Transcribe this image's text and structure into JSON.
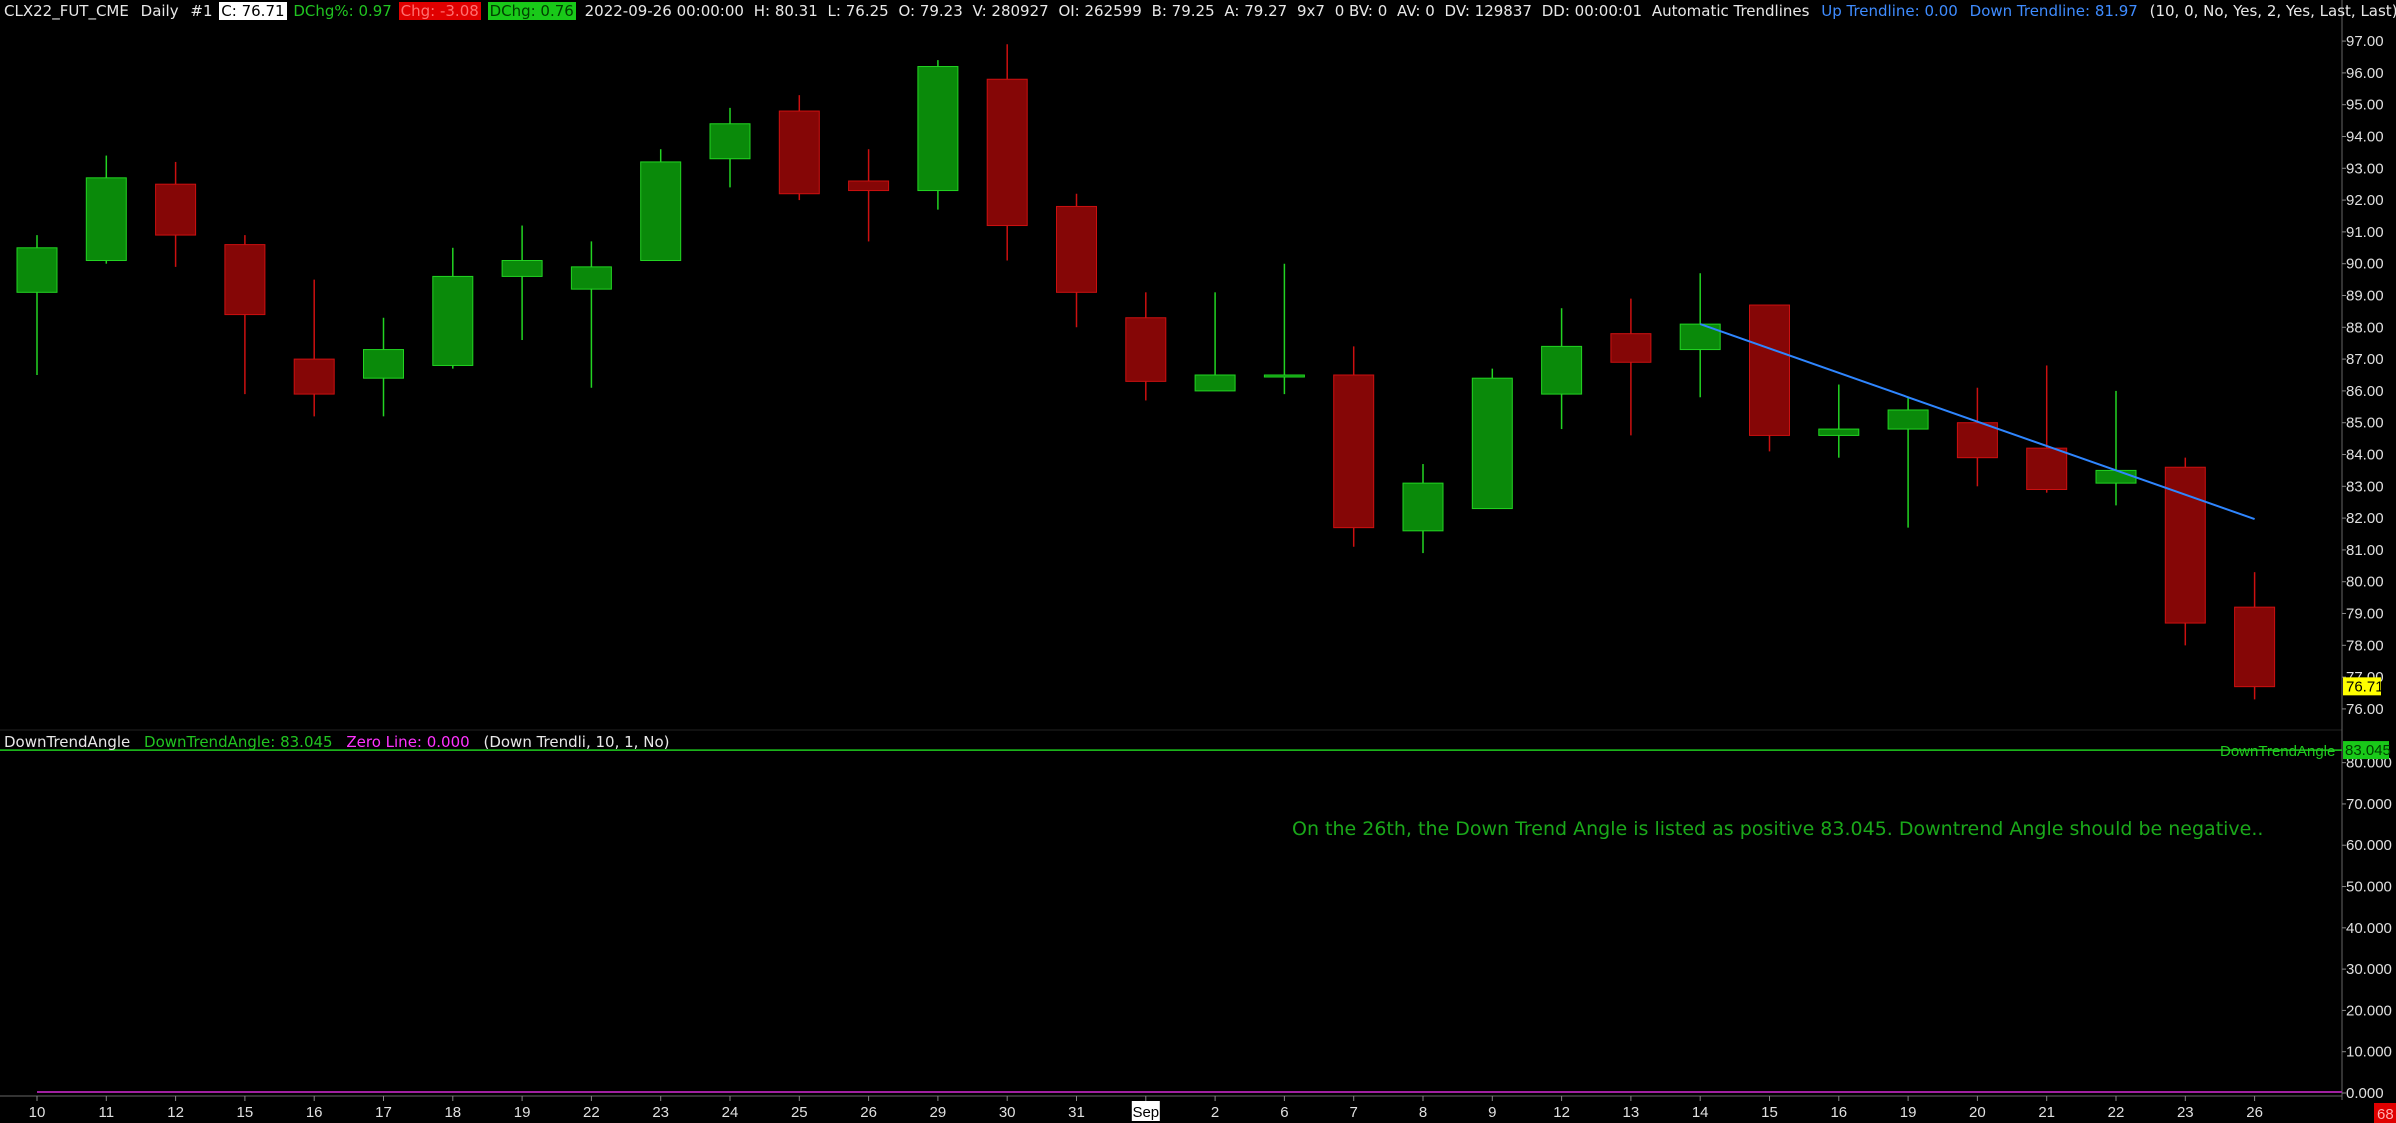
{
  "header": {
    "symbol": "CLX22_FUT_CME",
    "interval": "Daily",
    "chart_no": "#1",
    "close": "C: 76.71",
    "dchg_pct": "DChg%: 0.97",
    "chg": "Chg: -3.08",
    "dchg": "DChg: 0.76",
    "datetime": "2022-09-26 00:00:00",
    "high": "H: 80.31",
    "low": "L: 76.25",
    "open": "O: 79.23",
    "volume": "V: 280927",
    "oi": "OI: 262599",
    "bid": "B: 79.25",
    "ask": "A: 79.27",
    "size": "9x7",
    "bv": "0 BV: 0",
    "av": "AV: 0",
    "dv": "DV: 129837",
    "dd": "DD: 00:00:01",
    "study": "Automatic Trendlines",
    "up_trendline": "Up Trendline: 0.00",
    "down_trendline": "Down Trendline: 81.97",
    "params": "(10, 0, No, Yes, 2, Yes, Last, Last)"
  },
  "subheader": {
    "study": "DownTrendAngle",
    "value": "DownTrendAngle: 83.045",
    "zero": "Zero Line: 0.000",
    "params": "(Down Trendli, 10, 1, No)"
  },
  "annotation": "On the 26th, the Down Trend Angle is listed as positive 83.045.  Downtrend Angle should be negative..",
  "colors": {
    "up": "#0a8a0a",
    "up_border": "#22d422",
    "down": "#850606",
    "down_border": "#cc1010",
    "trendline": "#2f86ff",
    "indicator": "#1fcc1f",
    "zero_line": "#a020a0"
  },
  "chart_data": [
    {
      "type": "candlestick",
      "categories": [
        "10",
        "11",
        "12",
        "15",
        "16",
        "17",
        "18",
        "19",
        "22",
        "23",
        "24",
        "25",
        "26",
        "29",
        "30",
        "31",
        "Sep",
        "2",
        "6",
        "7",
        "8",
        "9",
        "12",
        "13",
        "14",
        "15",
        "16",
        "19",
        "20",
        "21",
        "22",
        "23",
        "26"
      ],
      "ohlc": [
        [
          89.1,
          90.9,
          86.5,
          90.5
        ],
        [
          90.1,
          93.4,
          90.0,
          92.7
        ],
        [
          92.5,
          93.2,
          89.9,
          90.9
        ],
        [
          90.6,
          90.9,
          85.9,
          88.4
        ],
        [
          87.0,
          89.5,
          85.2,
          85.9
        ],
        [
          86.4,
          88.3,
          85.2,
          87.3
        ],
        [
          86.8,
          90.5,
          86.7,
          89.6
        ],
        [
          89.6,
          91.2,
          87.6,
          90.1
        ],
        [
          89.2,
          90.7,
          86.1,
          89.9
        ],
        [
          90.1,
          93.6,
          90.1,
          93.2
        ],
        [
          93.3,
          94.9,
          92.4,
          94.4
        ],
        [
          94.8,
          95.3,
          92.0,
          92.2
        ],
        [
          92.6,
          93.6,
          90.7,
          92.3
        ],
        [
          92.3,
          96.4,
          91.7,
          96.2
        ],
        [
          95.8,
          96.9,
          90.1,
          91.2
        ],
        [
          91.8,
          92.2,
          88.0,
          89.1
        ],
        [
          88.3,
          89.1,
          85.7,
          86.3
        ],
        [
          86.0,
          89.1,
          86.0,
          86.5
        ],
        [
          86.5,
          90.0,
          85.9,
          86.5
        ],
        [
          86.5,
          87.4,
          81.1,
          81.7
        ],
        [
          81.6,
          83.7,
          80.9,
          83.1
        ],
        [
          82.3,
          86.7,
          82.3,
          86.4
        ],
        [
          85.9,
          88.6,
          84.8,
          87.4
        ],
        [
          87.8,
          88.9,
          84.6,
          86.9
        ],
        [
          87.3,
          89.7,
          85.8,
          88.1
        ],
        [
          88.7,
          88.7,
          84.1,
          84.6
        ],
        [
          84.6,
          86.2,
          83.9,
          84.8
        ],
        [
          84.8,
          85.8,
          81.7,
          85.4
        ],
        [
          85.0,
          86.1,
          83.0,
          83.9
        ],
        [
          84.2,
          86.8,
          82.8,
          82.9
        ],
        [
          83.1,
          86.0,
          82.4,
          83.5
        ],
        [
          83.6,
          83.9,
          78.0,
          78.7
        ],
        [
          79.2,
          80.3,
          76.3,
          76.7
        ]
      ],
      "trendline": {
        "name": "Down Trendline",
        "from": [
          "14",
          88.1
        ],
        "to": [
          "26",
          81.97
        ]
      },
      "last_price": 76.71,
      "yticks": [
        76,
        77,
        78,
        79,
        80,
        81,
        82,
        83,
        84,
        85,
        86,
        87,
        88,
        89,
        90,
        91,
        92,
        93,
        94,
        95,
        96,
        97
      ],
      "ytick_labels": [
        "76.00",
        "77.00",
        "78.00",
        "79.00",
        "80.00",
        "81.00",
        "82.00",
        "83.00",
        "84.00",
        "85.00",
        "86.00",
        "87.00",
        "88.00",
        "89.00",
        "90.00",
        "91.00",
        "92.00",
        "93.00",
        "94.00",
        "95.00",
        "96.00",
        "97.00"
      ],
      "ylim": [
        75.4,
        97.6
      ]
    },
    {
      "type": "line",
      "series": [
        {
          "name": "DownTrendAngle",
          "values": [
            83.045
          ]
        }
      ],
      "last_value_label": "83.045",
      "yticks": [
        0,
        10,
        20,
        30,
        40,
        50,
        60,
        70,
        80
      ],
      "ytick_labels": [
        "0.000",
        "10.000",
        "20.000",
        "30.000",
        "40.000",
        "50.000",
        "60.000",
        "70.000",
        "80.000"
      ],
      "ylim": [
        0,
        85
      ]
    }
  ]
}
